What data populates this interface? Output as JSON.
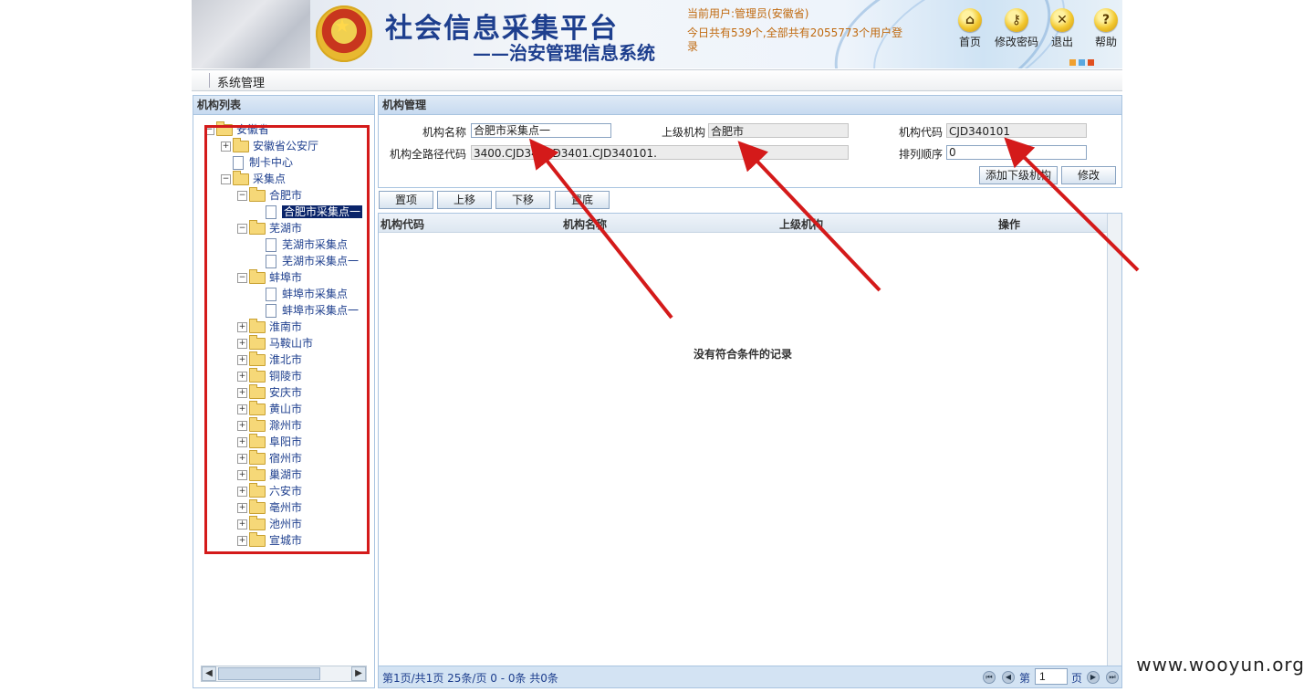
{
  "header": {
    "title": "社会信息采集平台",
    "subtitle": "——治安管理信息系统",
    "current_user": "当前用户:管理员(安徽省)",
    "stats": "今日共有539个,全部共有2055773个用户登录",
    "buttons": [
      {
        "label": "首页",
        "icon": "home-icon"
      },
      {
        "label": "修改密码",
        "icon": "key-icon"
      },
      {
        "label": "退出",
        "icon": "close-icon"
      },
      {
        "label": "帮助",
        "icon": "help-icon"
      }
    ]
  },
  "menu": {
    "item": "系统管理"
  },
  "tree": {
    "title": "机构列表",
    "nodes": [
      {
        "label": "安徽省",
        "level": 0,
        "toggle": "−",
        "type": "folder"
      },
      {
        "label": "安徽省公安厅",
        "level": 1,
        "toggle": "+",
        "type": "folder"
      },
      {
        "label": "制卡中心",
        "level": 1,
        "toggle": "",
        "type": "page"
      },
      {
        "label": "采集点",
        "level": 1,
        "toggle": "−",
        "type": "folder"
      },
      {
        "label": "合肥市",
        "level": 2,
        "toggle": "−",
        "type": "folder"
      },
      {
        "label": "合肥市采集点一",
        "level": 3,
        "toggle": "",
        "type": "page",
        "selected": true
      },
      {
        "label": "芜湖市",
        "level": 2,
        "toggle": "−",
        "type": "folder"
      },
      {
        "label": "芜湖市采集点",
        "level": 3,
        "toggle": "",
        "type": "page"
      },
      {
        "label": "芜湖市采集点一",
        "level": 3,
        "toggle": "",
        "type": "page"
      },
      {
        "label": "蚌埠市",
        "level": 2,
        "toggle": "−",
        "type": "folder"
      },
      {
        "label": "蚌埠市采集点",
        "level": 3,
        "toggle": "",
        "type": "page"
      },
      {
        "label": "蚌埠市采集点一",
        "level": 3,
        "toggle": "",
        "type": "page"
      },
      {
        "label": "淮南市",
        "level": 2,
        "toggle": "+",
        "type": "folder"
      },
      {
        "label": "马鞍山市",
        "level": 2,
        "toggle": "+",
        "type": "folder"
      },
      {
        "label": "淮北市",
        "level": 2,
        "toggle": "+",
        "type": "folder"
      },
      {
        "label": "铜陵市",
        "level": 2,
        "toggle": "+",
        "type": "folder"
      },
      {
        "label": "安庆市",
        "level": 2,
        "toggle": "+",
        "type": "folder"
      },
      {
        "label": "黄山市",
        "level": 2,
        "toggle": "+",
        "type": "folder"
      },
      {
        "label": "滁州市",
        "level": 2,
        "toggle": "+",
        "type": "folder"
      },
      {
        "label": "阜阳市",
        "level": 2,
        "toggle": "+",
        "type": "folder"
      },
      {
        "label": "宿州市",
        "level": 2,
        "toggle": "+",
        "type": "folder"
      },
      {
        "label": "巢湖市",
        "level": 2,
        "toggle": "+",
        "type": "folder"
      },
      {
        "label": "六安市",
        "level": 2,
        "toggle": "+",
        "type": "folder"
      },
      {
        "label": "亳州市",
        "level": 2,
        "toggle": "+",
        "type": "folder"
      },
      {
        "label": "池州市",
        "level": 2,
        "toggle": "+",
        "type": "folder"
      },
      {
        "label": "宣城市",
        "level": 2,
        "toggle": "+",
        "type": "folder"
      }
    ]
  },
  "form": {
    "title": "机构管理",
    "name_label": "机构名称",
    "name_value": "合肥市采集点一",
    "parent_label": "上级机构",
    "parent_value": "合肥市",
    "code_label": "机构代码",
    "code_value": "CJD340101",
    "path_label": "机构全路径代码",
    "path_value": "3400.CJD34.CJD3401.CJD340101.",
    "order_label": "排列顺序",
    "order_value": "0",
    "add_button": "添加下级机构",
    "edit_button": "修改"
  },
  "toolbar": {
    "top": "置项",
    "up": "上移",
    "down": "下移",
    "bottom": "置底"
  },
  "grid": {
    "columns": [
      "机构代码",
      "机构名称",
      "上级机构",
      "操作"
    ],
    "empty_text": "没有符合条件的记录"
  },
  "pager": {
    "info": "第1页/共1页  25条/页  0 - 0条  共0条",
    "page_prefix": "第",
    "page_value": "1",
    "page_suffix": "页"
  },
  "watermark": "www.wooyun.org",
  "colors": {
    "annotation_red": "#d41a1a",
    "title_blue": "#1e3f8e",
    "panel_border": "#a9c4e0"
  }
}
